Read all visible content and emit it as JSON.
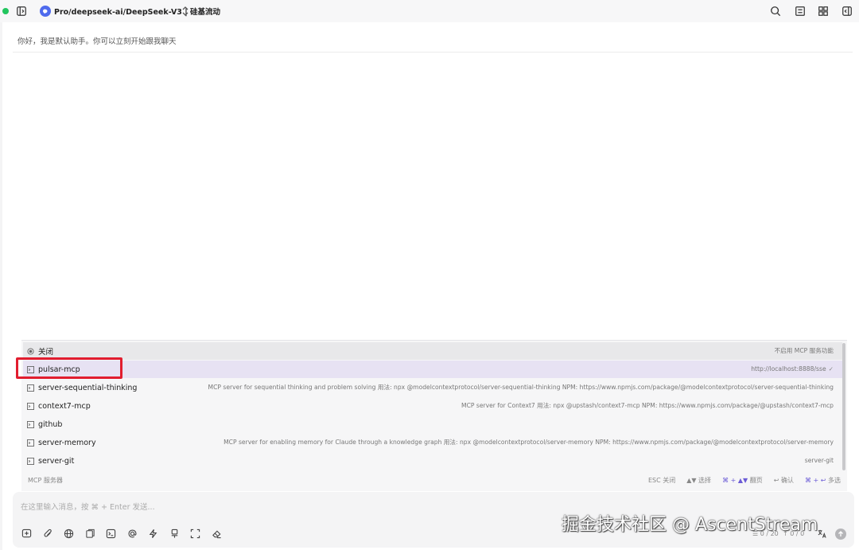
{
  "header": {
    "model_title": "Pro/deepseek-ai/DeepSeek-V3 | 硅基流动"
  },
  "chat": {
    "greeting": "你好，我是默认助手。你可以立刻开始跟我聊天"
  },
  "mcp_popup": {
    "items": [
      {
        "name": "关闭",
        "desc": "不启用 MCP 服务功能"
      },
      {
        "name": "pulsar-mcp",
        "desc": "http://localhost:8888/sse",
        "selected": true
      },
      {
        "name": "server-sequential-thinking",
        "desc": "MCP server for sequential thinking and problem solving 用法: npx @modelcontextprotocol/server-sequential-thinking NPM: https://www.npmjs.com/package/@modelcontextprotocol/server-sequential-thinking"
      },
      {
        "name": "context7-mcp",
        "desc": "MCP server for Context7 用法: npx @upstash/context7-mcp NPM: https://www.npmjs.com/package/@upstash/context7-mcp"
      },
      {
        "name": "github",
        "desc": ""
      },
      {
        "name": "server-memory",
        "desc": "MCP server for enabling memory for Claude through a knowledge graph 用法: npx @modelcontextprotocol/server-memory NPM: https://www.npmjs.com/package/@modelcontextprotocol/server-memory"
      },
      {
        "name": "server-git",
        "desc": "server-git"
      }
    ],
    "footer": {
      "title": "MCP 服务器",
      "hint_esc": "ESC 关闭",
      "hint_select": "▲▼ 选择",
      "hint_page_key": "⌘ + ▲▼",
      "hint_page": "翻页",
      "hint_confirm": "↩ 确认",
      "hint_multi_key": "⌘ + ↩",
      "hint_multi": "多选"
    }
  },
  "input": {
    "placeholder": "在这里输入消息，按 ⌘ + Enter 发送...",
    "token_count": "0 / 20",
    "context_count": "0 / 0"
  },
  "watermark": "掘金技术社区 @ AscentStream",
  "colors": {
    "accent": "#6b5bd6",
    "selected_row": "#e7e2f3",
    "highlight": "#e11d2f",
    "status": "#22c55e"
  },
  "icons": {
    "toolbar": [
      "new-topic-icon",
      "attachment-icon",
      "web-search-icon",
      "knowledge-base-icon",
      "mcp-server-icon",
      "mention-icon",
      "quick-phrase-icon",
      "clear-context-icon",
      "expand-icon",
      "eraser-icon",
      "translate-icon",
      "send-icon"
    ]
  }
}
